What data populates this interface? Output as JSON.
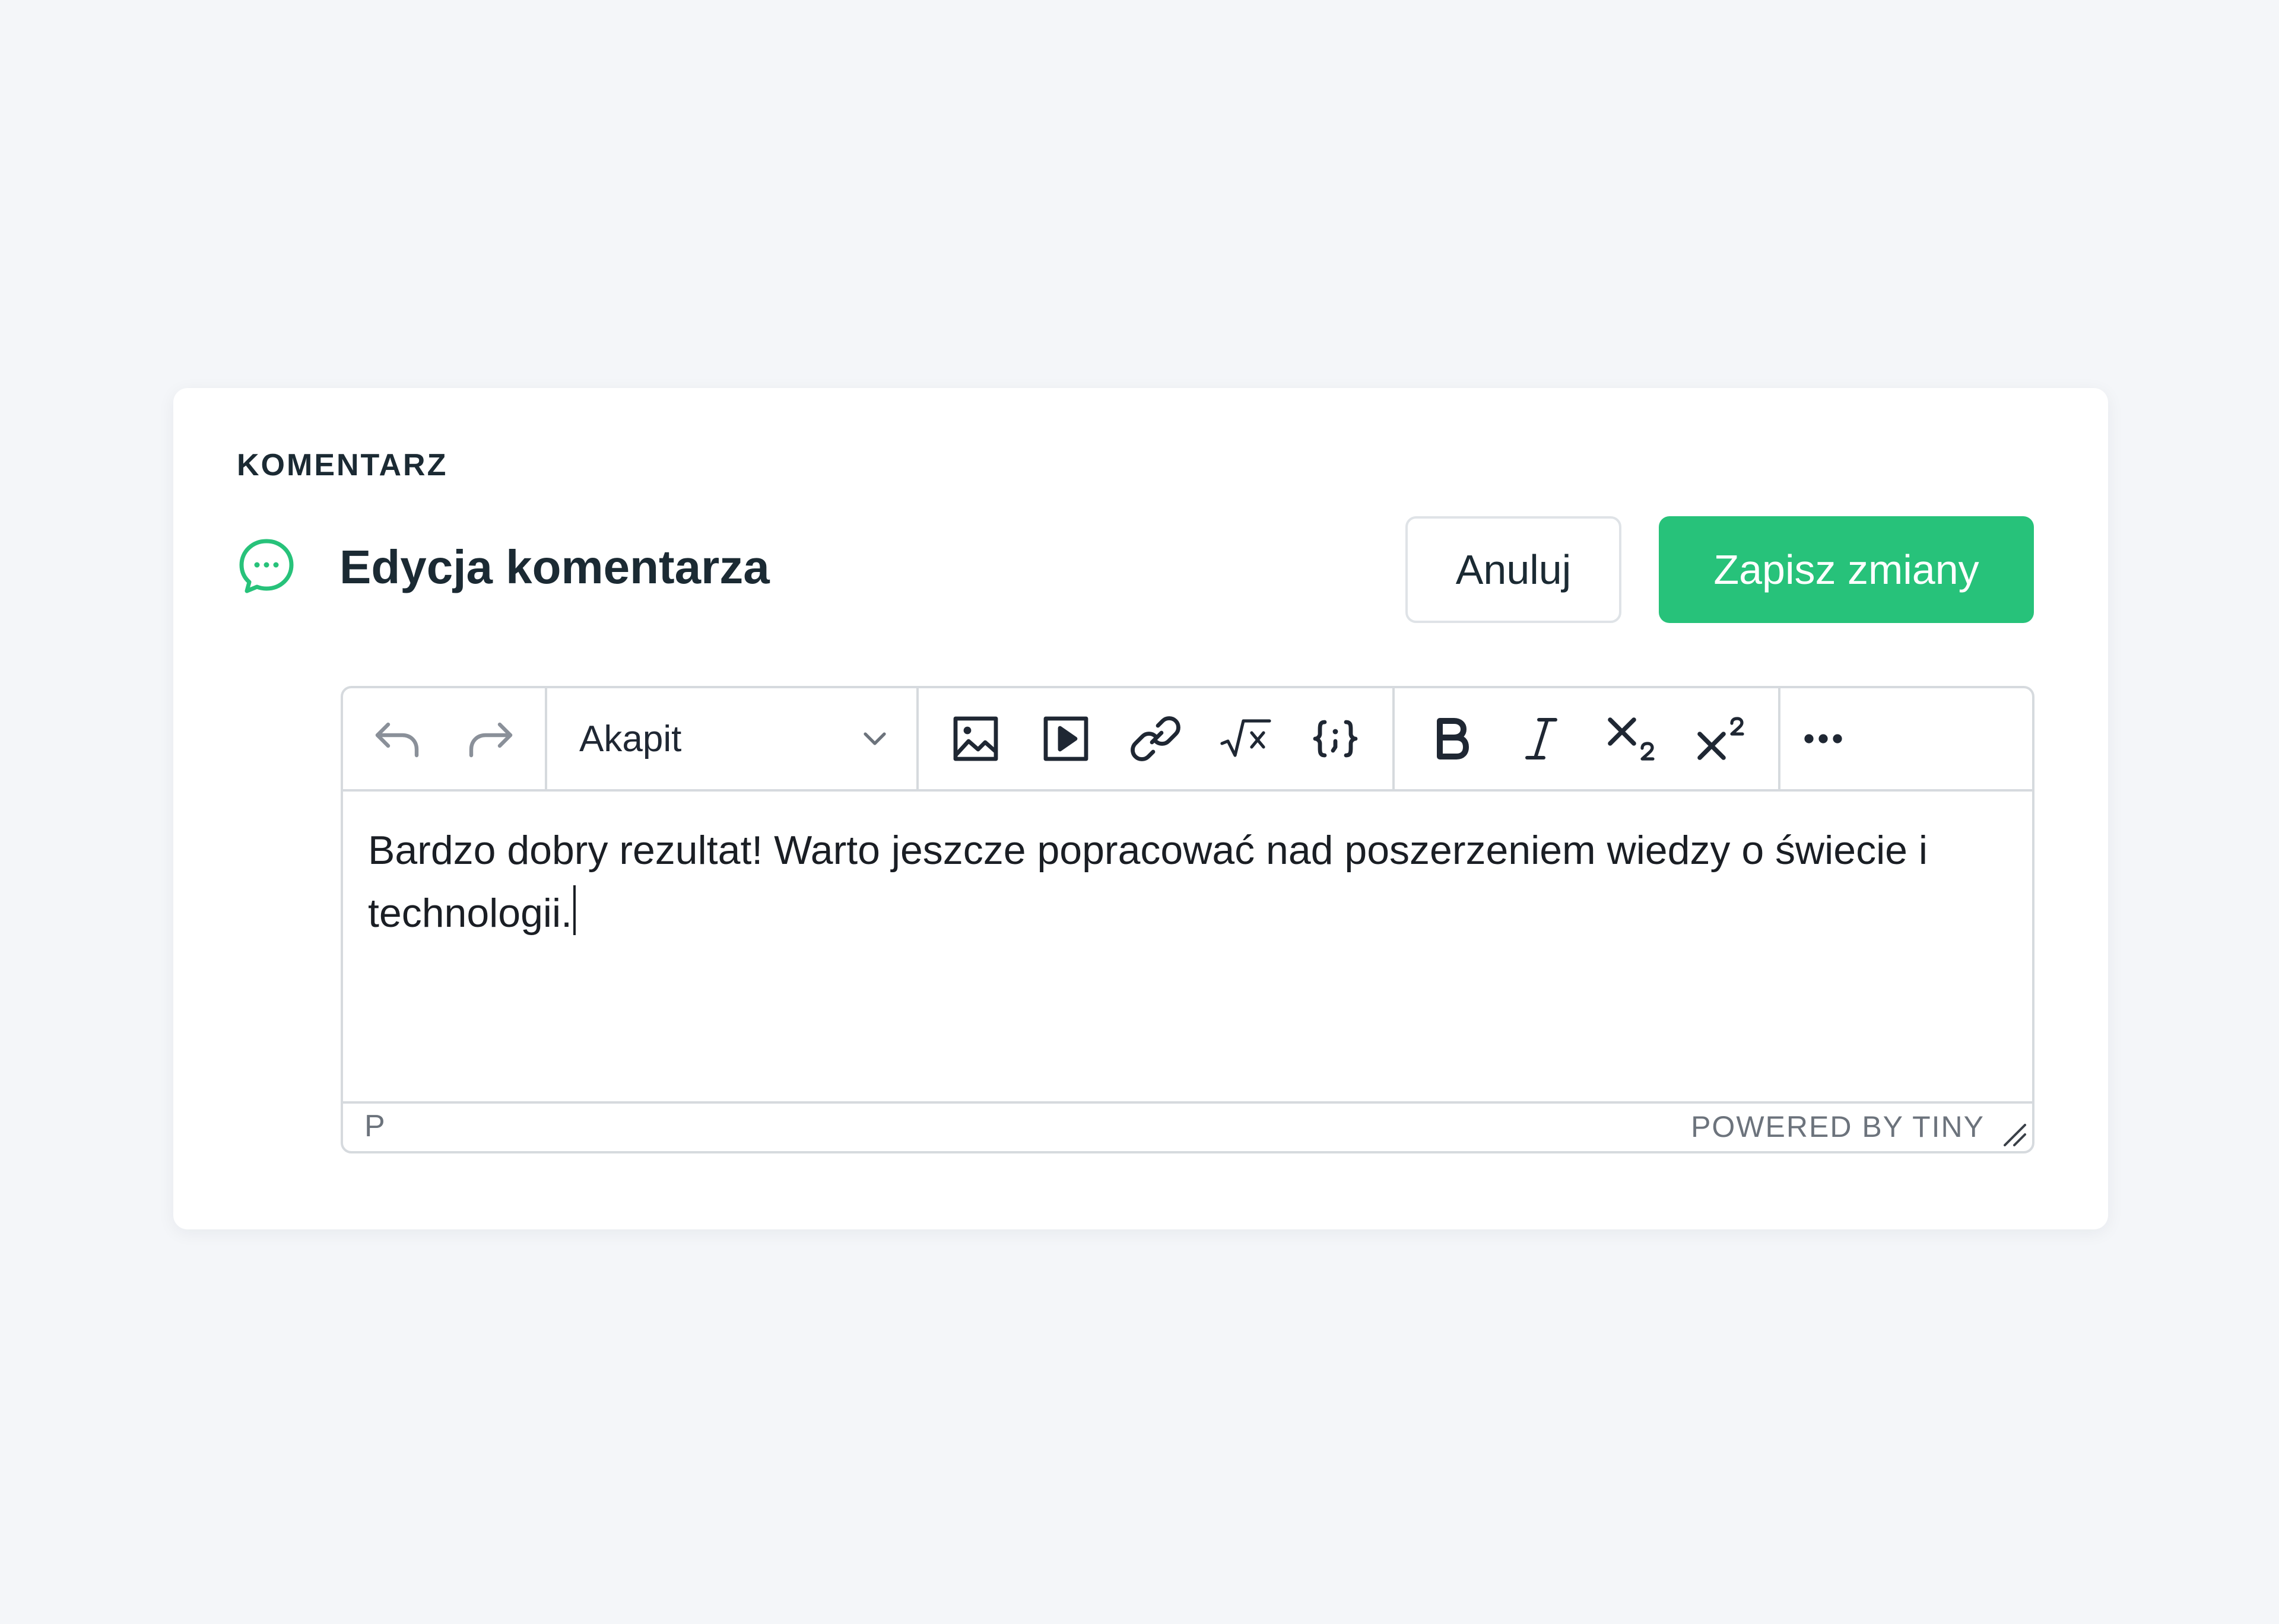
{
  "section": {
    "label": "KOMENTARZ"
  },
  "header": {
    "icon": "chat-bubble-icon",
    "title": "Edycja komentarza",
    "cancel_label": "Anuluj",
    "save_label": "Zapisz zmiany"
  },
  "colors": {
    "accent": "#27c27a",
    "background": "#f4f6f9",
    "text": "#1b2a33",
    "border": "#d6dade"
  },
  "toolbar": {
    "history": [
      "undo-icon",
      "redo-icon"
    ],
    "block_format": "Akapit",
    "insert": [
      "image-icon",
      "media-icon",
      "link-icon",
      "math-icon",
      "code-sample-icon"
    ],
    "formatting": [
      "bold-icon",
      "italic-icon",
      "subscript-icon",
      "superscript-icon"
    ],
    "more": "more-icon"
  },
  "editor": {
    "content": "Bardzo dobry rezultat! Warto jeszcze popracować nad poszerzeniem wiedzy o świecie i technologii."
  },
  "statusbar": {
    "path": "P",
    "branding": "POWERED BY TINY"
  }
}
